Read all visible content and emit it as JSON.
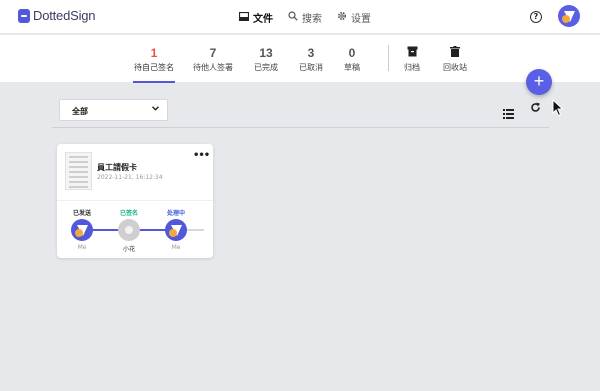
{
  "app": {
    "logo_text": "DottedSign"
  },
  "nav": {
    "items": [
      {
        "label": "文件",
        "icon": "inbox-icon",
        "active": true
      },
      {
        "label": "搜索",
        "icon": "search-icon",
        "active": false
      },
      {
        "label": "设置",
        "icon": "gear-icon",
        "active": false
      }
    ],
    "help_glyph": "?"
  },
  "tabs": [
    {
      "count": "1",
      "label": "待自己签名",
      "active": true
    },
    {
      "count": "7",
      "label": "待他人签署",
      "active": false
    },
    {
      "count": "13",
      "label": "已完成",
      "active": false
    },
    {
      "count": "3",
      "label": "已取消",
      "active": false
    },
    {
      "count": "0",
      "label": "草稿",
      "active": false
    }
  ],
  "tab_actions": [
    {
      "label": "归档",
      "icon": "archive-icon"
    },
    {
      "label": "回收站",
      "icon": "trash-icon"
    }
  ],
  "fab_glyph": "+",
  "filter": {
    "selected": "全部"
  },
  "document": {
    "title": "員工請假卡",
    "time": "2022-11-21, 16:12:34",
    "steps": [
      {
        "status": "已发送",
        "status_color": "#333333",
        "who": "Me"
      },
      {
        "status": "已签名",
        "status_color": "#19b48e",
        "who": "小花"
      },
      {
        "status": "处理中",
        "status_color": "#3b5fd8",
        "who": "Me"
      }
    ]
  },
  "colors": {
    "accent": "#5358d8",
    "active_tab": "#e8543e",
    "background": "#e6e8ec"
  }
}
